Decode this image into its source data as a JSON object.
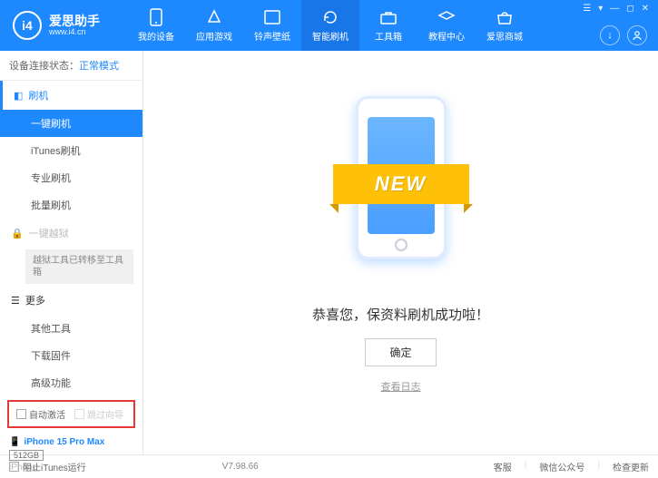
{
  "header": {
    "appName": "爱思助手",
    "appUrl": "www.i4.cn",
    "tabs": [
      {
        "label": "我的设备"
      },
      {
        "label": "应用游戏"
      },
      {
        "label": "铃声壁纸"
      },
      {
        "label": "智能刷机"
      },
      {
        "label": "工具箱"
      },
      {
        "label": "教程中心"
      },
      {
        "label": "爱思商城"
      }
    ],
    "windowControls": {
      "tip": "▾"
    }
  },
  "status": {
    "label": "设备连接状态：",
    "value": "正常模式"
  },
  "sidebar": {
    "flash": {
      "title": "刷机",
      "items": [
        "一键刷机",
        "iTunes刷机",
        "专业刷机",
        "批量刷机"
      ]
    },
    "jailbreak": {
      "title": "一键越狱",
      "note": "越狱工具已转移至工具箱"
    },
    "more": {
      "title": "更多",
      "items": [
        "其他工具",
        "下载固件",
        "高级功能"
      ]
    },
    "checkboxes": {
      "auto": "自动激活",
      "skip": "跳过向导"
    }
  },
  "device": {
    "name": "iPhone 15 Pro Max",
    "storage": "512GB",
    "type": "iPhone"
  },
  "content": {
    "newBadge": "NEW",
    "message": "恭喜您，保资料刷机成功啦！",
    "okBtn": "确定",
    "logLink": "查看日志"
  },
  "footer": {
    "blockItunes": "阻止iTunes运行",
    "version": "V7.98.66",
    "links": [
      "客服",
      "微信公众号",
      "检查更新"
    ]
  }
}
